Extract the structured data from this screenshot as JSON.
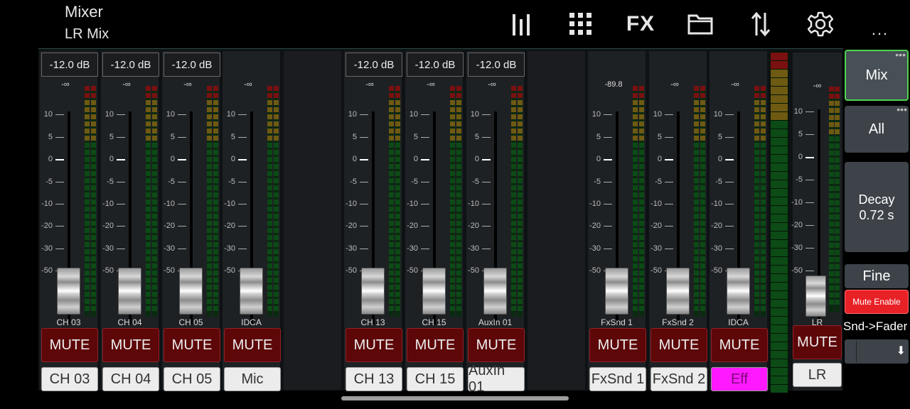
{
  "header": {
    "title": "Mixer",
    "subtitle": "LR Mix",
    "fx_label": "FX",
    "more_label": "..."
  },
  "scale_labels": [
    "10",
    "5",
    "0",
    "-5",
    "-10",
    "-20",
    "-30",
    "-50"
  ],
  "channels": [
    {
      "gain": "-12.0 dB",
      "peak": "-∞",
      "strip_label": "CH 03",
      "mute": "MUTE",
      "name": "CH 03"
    },
    {
      "gain": "-12.0 dB",
      "peak": "-∞",
      "strip_label": "CH 04",
      "mute": "MUTE",
      "name": "CH 04"
    },
    {
      "gain": "-12.0 dB",
      "peak": "-∞",
      "strip_label": "CH 05",
      "mute": "MUTE",
      "name": "CH 05"
    },
    {
      "gain": "",
      "peak": "-∞",
      "strip_label": "IDCA",
      "mute": "MUTE",
      "name": "Mic"
    },
    {
      "empty": true
    },
    {
      "gain": "-12.0 dB",
      "peak": "-∞",
      "strip_label": "CH 13",
      "mute": "MUTE",
      "name": "CH 13"
    },
    {
      "gain": "-12.0 dB",
      "peak": "-∞",
      "strip_label": "CH 15",
      "mute": "MUTE",
      "name": "CH 15"
    },
    {
      "gain": "-12.0 dB",
      "peak": "-∞",
      "strip_label": "AuxIn 01",
      "mute": "MUTE",
      "name": "AuxIn 01"
    },
    {
      "empty": true
    },
    {
      "gain": "",
      "peak": "-89.8",
      "strip_label": "FxSnd 1",
      "mute": "MUTE",
      "name": "FxSnd 1"
    },
    {
      "gain": "",
      "peak": "-∞",
      "strip_label": "FxSnd 2",
      "mute": "MUTE",
      "name": "FxSnd 2"
    },
    {
      "gain": "",
      "peak": "-∞",
      "strip_label": "IDCA",
      "mute": "MUTE",
      "name": "Eff",
      "highlight": true
    }
  ],
  "lr": {
    "peak": "-∞",
    "strip_label": "LR",
    "mute": "MUTE",
    "name": "LR"
  },
  "right_panel": {
    "mix": "Mix",
    "all": "All",
    "decay_label": "Decay",
    "decay_value": "0.72 s",
    "fine": "Fine",
    "mute_enable": "Mute Enable",
    "snd_fader": "Snd->Fader"
  },
  "colors": {
    "mute_bg": "#5d0709",
    "eff_highlight": "#ff19ff",
    "mix_border": "#4fd44f",
    "mute_enable_bg": "#e82127"
  }
}
